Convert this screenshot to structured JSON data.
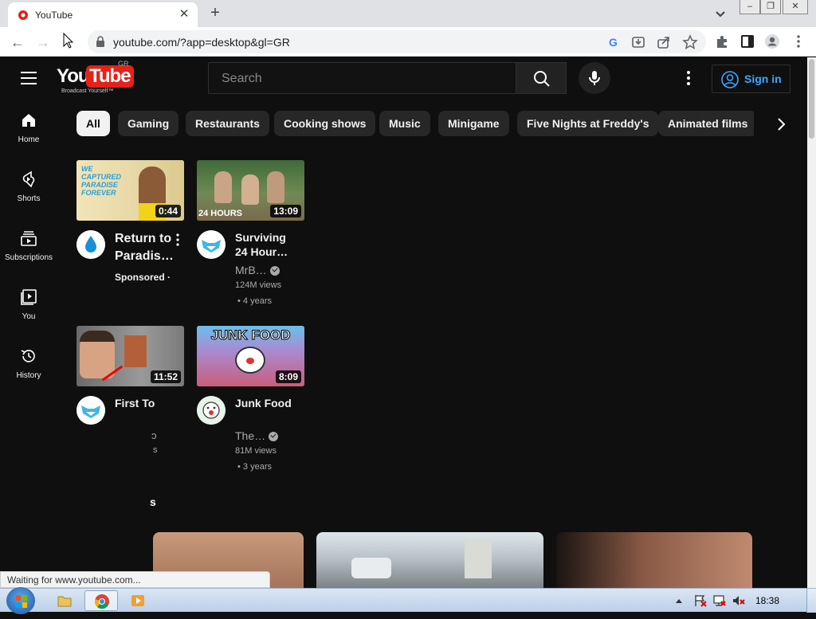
{
  "browser": {
    "tab_title": "YouTube",
    "url": "youtube.com/?app=desktop&gl=GR",
    "status_text": "Waiting for www.youtube.com..."
  },
  "header": {
    "logo_you": "You",
    "logo_tube": "Tube",
    "logo_tagline": "Broadcast Yourself™",
    "country_code": "GR",
    "search_placeholder": "Search",
    "sign_in_label": "Sign in"
  },
  "sidebar": {
    "items": [
      {
        "label": "Home",
        "icon": "home-icon"
      },
      {
        "label": "Shorts",
        "icon": "shorts-icon"
      },
      {
        "label": "Subscriptions",
        "icon": "subscriptions-icon"
      },
      {
        "label": "You",
        "icon": "you-icon"
      },
      {
        "label": "History",
        "icon": "history-icon"
      }
    ]
  },
  "chips": [
    "All",
    "Gaming",
    "Restaurants",
    "Cooking shows",
    "Music",
    "Minigame",
    "Five Nights at Freddy's",
    "Animated films"
  ],
  "videos": [
    {
      "title": "Return to Paradis…",
      "duration": "0:44",
      "badge": "Sponsored ·",
      "thumb_text": "WE CAPTURED PARADISE FOREVER"
    },
    {
      "title": "Surviving 24 Hour…",
      "duration": "13:09",
      "channel": "MrB…",
      "views": "124M views",
      "age": "• 4 years",
      "thumb_text": "24 HOURS"
    },
    {
      "title": "First To",
      "duration": "11:52"
    },
    {
      "title": "Junk Food",
      "duration": "8:09",
      "channel": "The…",
      "views": "81M views",
      "age": "• 3 years",
      "thumb_text": "JUNK FOOD"
    }
  ],
  "partial_text": {
    "a": "ɔ",
    "b": "s",
    "c": "s"
  },
  "taskbar": {
    "clock": "18:38"
  },
  "colors": {
    "background": "#0f0f0f",
    "chip": "#272727",
    "accent_blue": "#3ea6ff",
    "youtube_red": "#e62117"
  }
}
